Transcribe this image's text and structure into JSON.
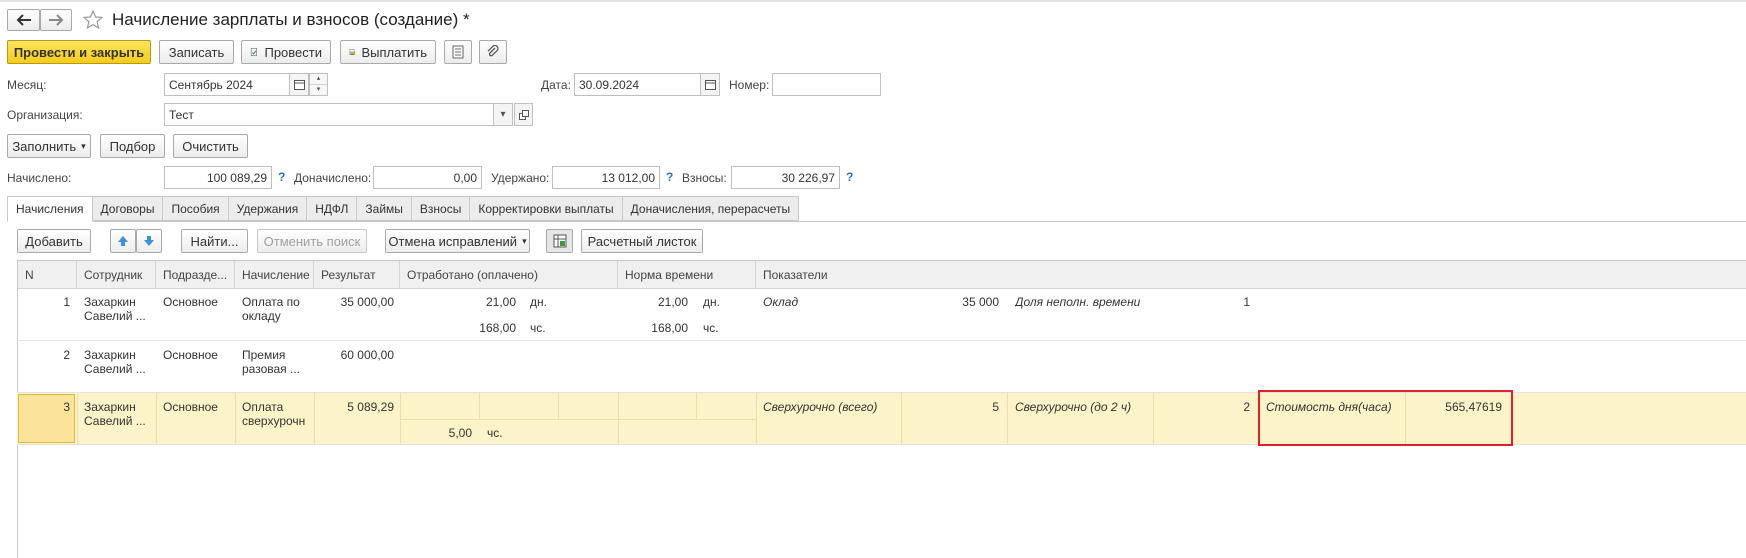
{
  "window": {
    "title": "Начисление зарплаты и взносов (создание) *"
  },
  "toolbar": {
    "post_close": "Провести и закрыть",
    "save": "Записать",
    "post": "Провести",
    "pay": "Выплатить"
  },
  "header": {
    "month_label": "Месяц:",
    "month_value": "Сентябрь 2024",
    "date_label": "Дата:",
    "date_value": "30.09.2024",
    "number_label": "Номер:",
    "number_value": "",
    "org_label": "Организация:",
    "org_value": "Тест"
  },
  "actions": {
    "fill": "Заполнить",
    "select": "Подбор",
    "clear": "Очистить"
  },
  "totals": {
    "accrued_label": "Начислено:",
    "accrued_value": "100 089,29",
    "extra_label": "Доначислено:",
    "extra_value": "0,00",
    "withheld_label": "Удержано:",
    "withheld_value": "13 012,00",
    "contrib_label": "Взносы:",
    "contrib_value": "30 226,97",
    "help": "?"
  },
  "tabs": [
    "Начисления",
    "Договоры",
    "Пособия",
    "Удержания",
    "НДФЛ",
    "Займы",
    "Взносы",
    "Корректировки выплаты",
    "Доначисления, перерасчеты"
  ],
  "grid_toolbar": {
    "add": "Добавить",
    "find": "Найти...",
    "cancel_search": "Отменить поиск",
    "cancel_fix": "Отмена исправлений",
    "payslip": "Расчетный листок"
  },
  "columns": [
    "N",
    "Сотрудник",
    "Подразде...",
    "Начисление",
    "Результат",
    "Отработано (оплачено)",
    "Норма времени",
    "Показатели"
  ],
  "rows": [
    {
      "n": "1",
      "emp1": "Захаркин",
      "emp2": "Савелий ...",
      "dept": "Основное",
      "acc1": "Оплата по",
      "acc2": "окладу",
      "result": "35 000,00",
      "work_days": "21,00",
      "work_days_unit": "дн.",
      "work_hours": "168,00",
      "work_hours_unit": "чс.",
      "norm_days": "21,00",
      "norm_days_unit": "дн.",
      "norm_hours": "168,00",
      "norm_hours_unit": "чс.",
      "ind1_name": "Оклад",
      "ind1_value": "35 000",
      "ind2_name": "Доля неполн. времени",
      "ind2_value": "1"
    },
    {
      "n": "2",
      "emp1": "Захаркин",
      "emp2": "Савелий ...",
      "dept": "Основное",
      "acc1": "Премия",
      "acc2": "разовая ...",
      "result": "60 000,00"
    },
    {
      "n": "3",
      "emp1": "Захаркин",
      "emp2": "Савелий ...",
      "dept": "Основное",
      "acc1": "Оплата",
      "acc2": "сверхурочн",
      "result": "5 089,29",
      "work_hours": "5,00",
      "work_hours_unit": "чс.",
      "ind1_name": "Сверхурочно (всего)",
      "ind1_value": "5",
      "ind2_name": "Сверхурочно (до 2 ч)",
      "ind2_value": "2",
      "ind3_name": "Стоимость дня(часа)",
      "ind3_value": "565,47619"
    }
  ],
  "colors": {
    "primary_button": "#f6cc1a",
    "selected_row": "#fdf3c8",
    "highlight_box": "#e0202a",
    "help_link": "#2f6fd1"
  }
}
